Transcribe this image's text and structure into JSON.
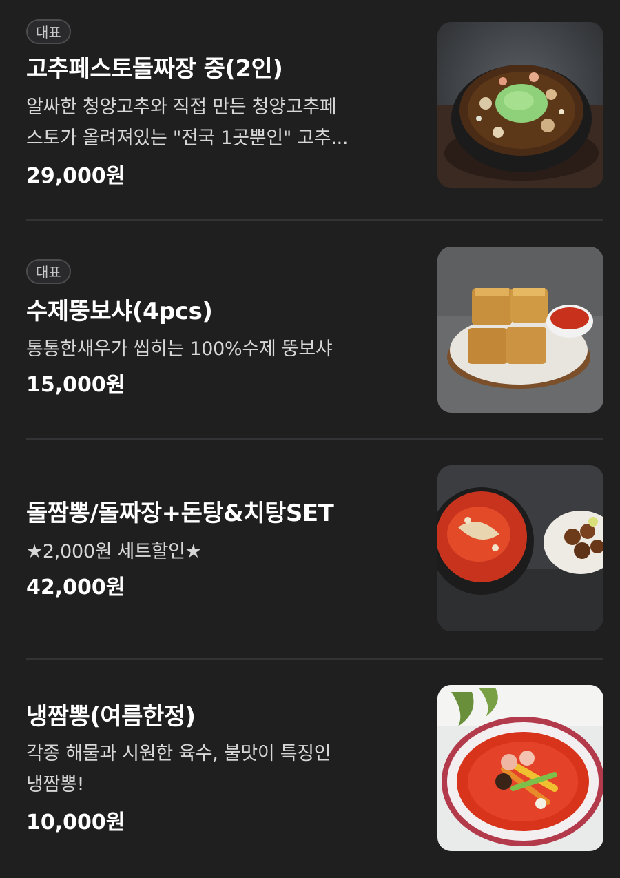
{
  "menu": {
    "items": [
      {
        "badge": "대표",
        "title": "고추페스토돌짜장 중(2인)",
        "desc_line1": "알싸한 청양고추와 직접 만든 청양고추페",
        "desc_line2": "스토가 올려져있는 \"전국 1곳뿐인\" 고추...",
        "price": "29,000원",
        "image_icon": "stone-pot-jjajang-photo"
      },
      {
        "badge": "대표",
        "title": "수제뚱보샤(4pcs)",
        "desc_line1": "통통한새우가 씹히는 100%수제 뚱보샤",
        "price": "15,000원",
        "image_icon": "fried-shrimp-toast-photo"
      },
      {
        "title": "돌짬뽕/돌짜장+돈탕&치탕SET",
        "desc_line1": "★2,000원 세트할인★",
        "price": "42,000원",
        "image_icon": "jjamppong-set-photo"
      },
      {
        "title": "냉짬뽕(여름한정)",
        "desc_line1": "각종 해물과 시원한 육수, 불맛이 특징인",
        "desc_line2": "냉짬뽕!",
        "price": "10,000원",
        "image_icon": "cold-jjamppong-photo"
      }
    ]
  },
  "colors": {
    "background": "#1f1f20",
    "divider": "#333335",
    "text_primary": "#ffffff",
    "text_secondary": "#d7d7d7"
  }
}
